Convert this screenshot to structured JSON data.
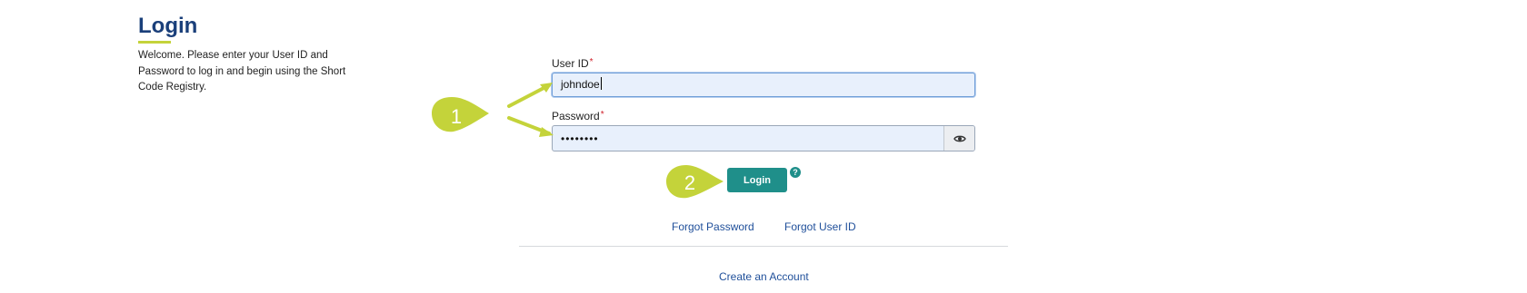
{
  "intro": {
    "title": "Login",
    "line1": "Welcome. Please enter your User ID and",
    "line2": "Password to log in and begin using the Short",
    "line3": "Code Registry."
  },
  "form": {
    "user_id_label": "User ID",
    "user_id_value": "johndoe",
    "password_label": "Password",
    "password_value": "••••••••",
    "required_marker": "*",
    "login_label": "Login",
    "help_glyph": "?"
  },
  "links": {
    "forgot_password": "Forgot Password",
    "forgot_user_id": "Forgot User ID",
    "create_account": "Create an Account"
  },
  "callouts": {
    "step1": "1",
    "step2": "2"
  },
  "icons": {
    "show_password": "eye-icon",
    "help": "question-circle-icon"
  },
  "colors": {
    "title": "#1a3f7a",
    "accent_underline": "#c4d33a",
    "primary_button": "#1f8f8a",
    "link": "#1f4f9a",
    "input_background": "#e8f0fc",
    "required": "#d0202a",
    "callout": "#c4d33a"
  }
}
